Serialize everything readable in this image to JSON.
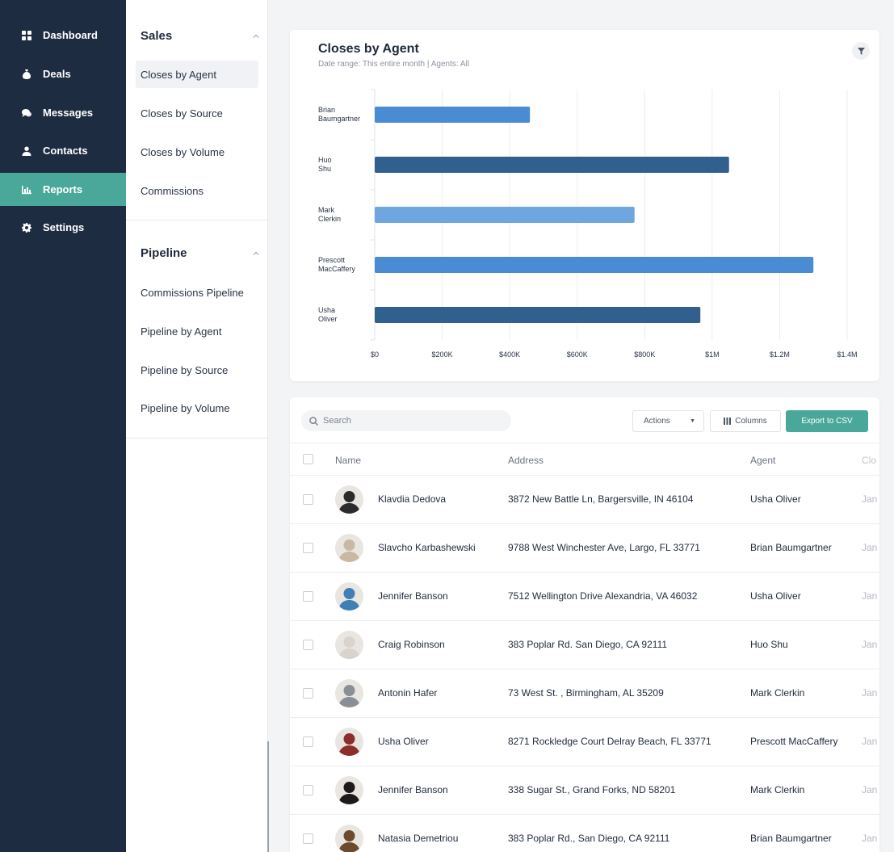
{
  "nav": {
    "items": [
      {
        "label": "Dashboard",
        "icon": "grid-icon"
      },
      {
        "label": "Deals",
        "icon": "money-bag-icon"
      },
      {
        "label": "Messages",
        "icon": "chat-bubbles-icon"
      },
      {
        "label": "Contacts",
        "icon": "person-icon"
      },
      {
        "label": "Reports",
        "icon": "bar-chart-icon",
        "active": true
      },
      {
        "label": "Settings",
        "icon": "gear-icon"
      }
    ]
  },
  "submenu": {
    "sales": {
      "title": "Sales",
      "items": [
        "Closes by Agent",
        "Closes by Source",
        "Closes by Volume",
        "Commissions"
      ]
    },
    "pipeline": {
      "title": "Pipeline",
      "items": [
        "Commissions Pipeline",
        "Pipeline by Agent",
        "Pipeline by Source",
        "Pipeline by Volume"
      ]
    }
  },
  "report": {
    "title": "Closes by Agent",
    "subtitle": "Date range: This entire month  |  Agents: All"
  },
  "chart_data": {
    "type": "bar",
    "orientation": "horizontal",
    "categories": [
      [
        "Brian",
        "Baumgartner"
      ],
      [
        "Huo",
        "Shu"
      ],
      [
        "Mark",
        "Clerkin"
      ],
      [
        "Prescott",
        "MacCaffery"
      ],
      [
        "Usha",
        "Oliver"
      ]
    ],
    "values": [
      460000,
      1050000,
      770000,
      1300000,
      965000
    ],
    "bar_colors": [
      "#4a8cd3",
      "#31608f",
      "#6ea6df",
      "#4a8cd3",
      "#31608f"
    ],
    "x_ticks": [
      0,
      200000,
      400000,
      600000,
      800000,
      1000000,
      1200000,
      1400000
    ],
    "x_tick_labels": [
      "$0",
      "$200K",
      "$400K",
      "$600K",
      "$800K",
      "$1M",
      "$1.2M",
      "$1.4M"
    ],
    "xlim": [
      0,
      1400000
    ],
    "grid": true
  },
  "table": {
    "search_placeholder": "Search",
    "actions_label": "Actions",
    "columns_label": "Columns",
    "export_label": "Export to CSV",
    "headers": {
      "name": "Name",
      "address": "Address",
      "agent": "Agent",
      "close": "Clo"
    },
    "rows": [
      {
        "name": "Klavdia Dedova",
        "address": "3872 New Battle Ln, Bargersville, IN 46104",
        "agent": "Usha Oliver",
        "date": "Jan",
        "avatar_color": "#2b2b2b"
      },
      {
        "name": "Slavcho Karbashewski",
        "address": "9788 West Winchester Ave, Largo, FL 33771",
        "agent": "Brian Baumgartner",
        "date": "Jan",
        "avatar_color": "#c9b8a3"
      },
      {
        "name": "Jennifer Banson",
        "address": "7512 Wellington Drive Alexandria, VA 46032",
        "agent": "Usha Oliver",
        "date": "Jan",
        "avatar_color": "#3f7fb3"
      },
      {
        "name": "Craig Robinson",
        "address": "383 Poplar Rd. San Diego, CA 92111",
        "agent": "Huo Shu",
        "date": "Jan",
        "avatar_color": "#d8d3cc"
      },
      {
        "name": "Antonin Hafer",
        "address": "73 West St. , Birmingham, AL 35209",
        "agent": "Mark Clerkin",
        "date": "Jan",
        "avatar_color": "#8a8f96"
      },
      {
        "name": "Usha Oliver",
        "address": "8271 Rockledge Court Delray Beach, FL 33771",
        "agent": "Prescott MacCaffery",
        "date": "Jan",
        "avatar_color": "#8a2f2a"
      },
      {
        "name": "Jennifer Banson",
        "address": "338 Sugar St., Grand Forks, ND 58201",
        "agent": "Mark Clerkin",
        "date": "Jan",
        "avatar_color": "#1e1a1a"
      },
      {
        "name": "Natasia Demetriou",
        "address": "383 Poplar Rd., San Diego, CA 92111",
        "agent": "Brian Baumgartner",
        "date": "Jan",
        "avatar_color": "#6b4a2e"
      }
    ]
  }
}
